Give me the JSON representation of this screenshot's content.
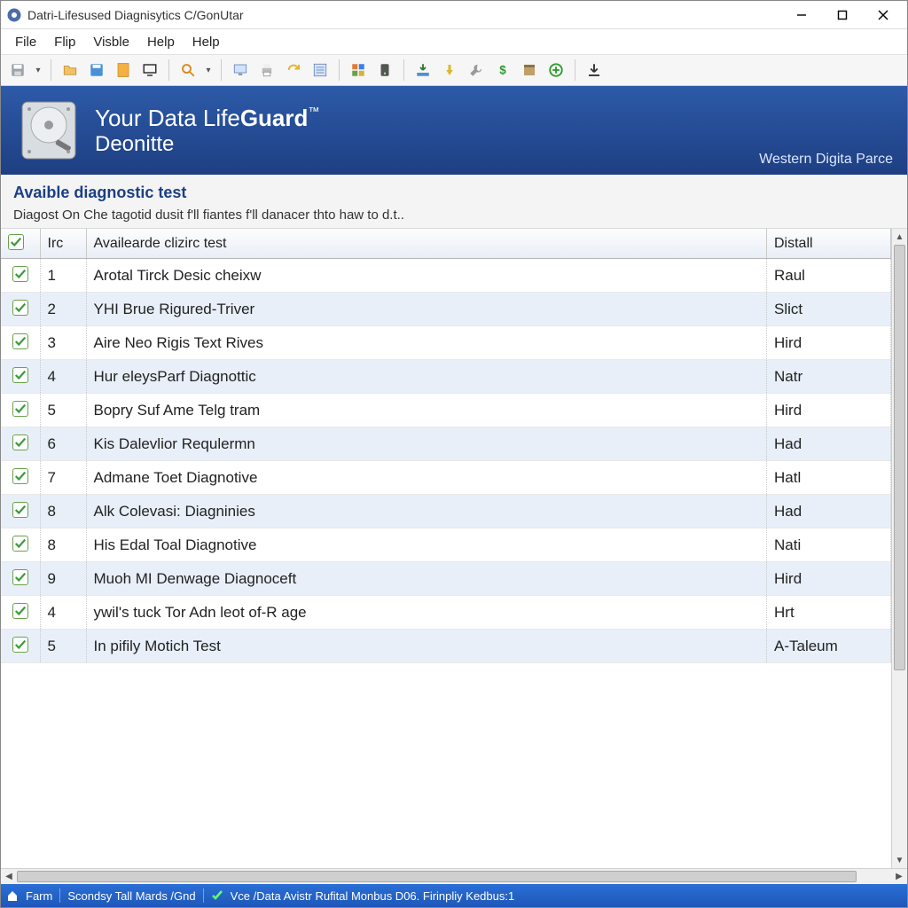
{
  "window": {
    "title": "Datri-Lifesused Diagnisytics C/GonUtar"
  },
  "menubar": [
    "File",
    "Flip",
    "Visble",
    "Help",
    "Help"
  ],
  "banner": {
    "line1_pre": "Your Data Life",
    "line1_bold": "Guard",
    "line1_tm": "™",
    "line2": "Deonitte",
    "brand": "Western Digita Parce"
  },
  "section": {
    "title": "Avaible diagnostic test",
    "desc": "Diagost On Che tagotid dusit f'll fiantes f'll danacer thto haw to d.t.."
  },
  "table": {
    "headers": {
      "check": "",
      "idx": "Irc",
      "name": "Availearde clizirc test",
      "status": "Distall"
    },
    "rows": [
      {
        "idx": "1",
        "name": "Arotal Tirck Desic cheixw",
        "status": "Raul"
      },
      {
        "idx": "2",
        "name": "YHI Brue Rigured-Triver",
        "status": "Slict"
      },
      {
        "idx": "3",
        "name": "Aire Neo Rigis Text Rives",
        "status": "Hird"
      },
      {
        "idx": "4",
        "name": "Hur eleysParf Diagnottic",
        "status": "Natr"
      },
      {
        "idx": "5",
        "name": "Bopry Suf Ame Telg tram",
        "status": "Hird"
      },
      {
        "idx": "6",
        "name": "Kis Dalevlior Requlermn",
        "status": "Had"
      },
      {
        "idx": "7",
        "name": "Admane Toet Diagnotive",
        "status": "Hatl"
      },
      {
        "idx": "8",
        "name": "Alk Colevasi: Diagninies",
        "status": "Had"
      },
      {
        "idx": "8",
        "name": "His Edal Toal Diagnotive",
        "status": "Nati"
      },
      {
        "idx": "9",
        "name": "Muoh MI Denwage Diagnoceft",
        "status": "Hird"
      },
      {
        "idx": "4",
        "name": "ywil's tuck Tor Adn leot of-R age",
        "status": "Hrt"
      },
      {
        "idx": "5",
        "name": "In pifily Motich Test",
        "status": "A-Taleum"
      }
    ]
  },
  "statusbar": {
    "left1": "Farm",
    "left2": "Scondsy Tall Mards /Gnd",
    "right": "Vce /Data Avistr Rufital Monbus D06. Firinpliy Kedbus:1"
  }
}
